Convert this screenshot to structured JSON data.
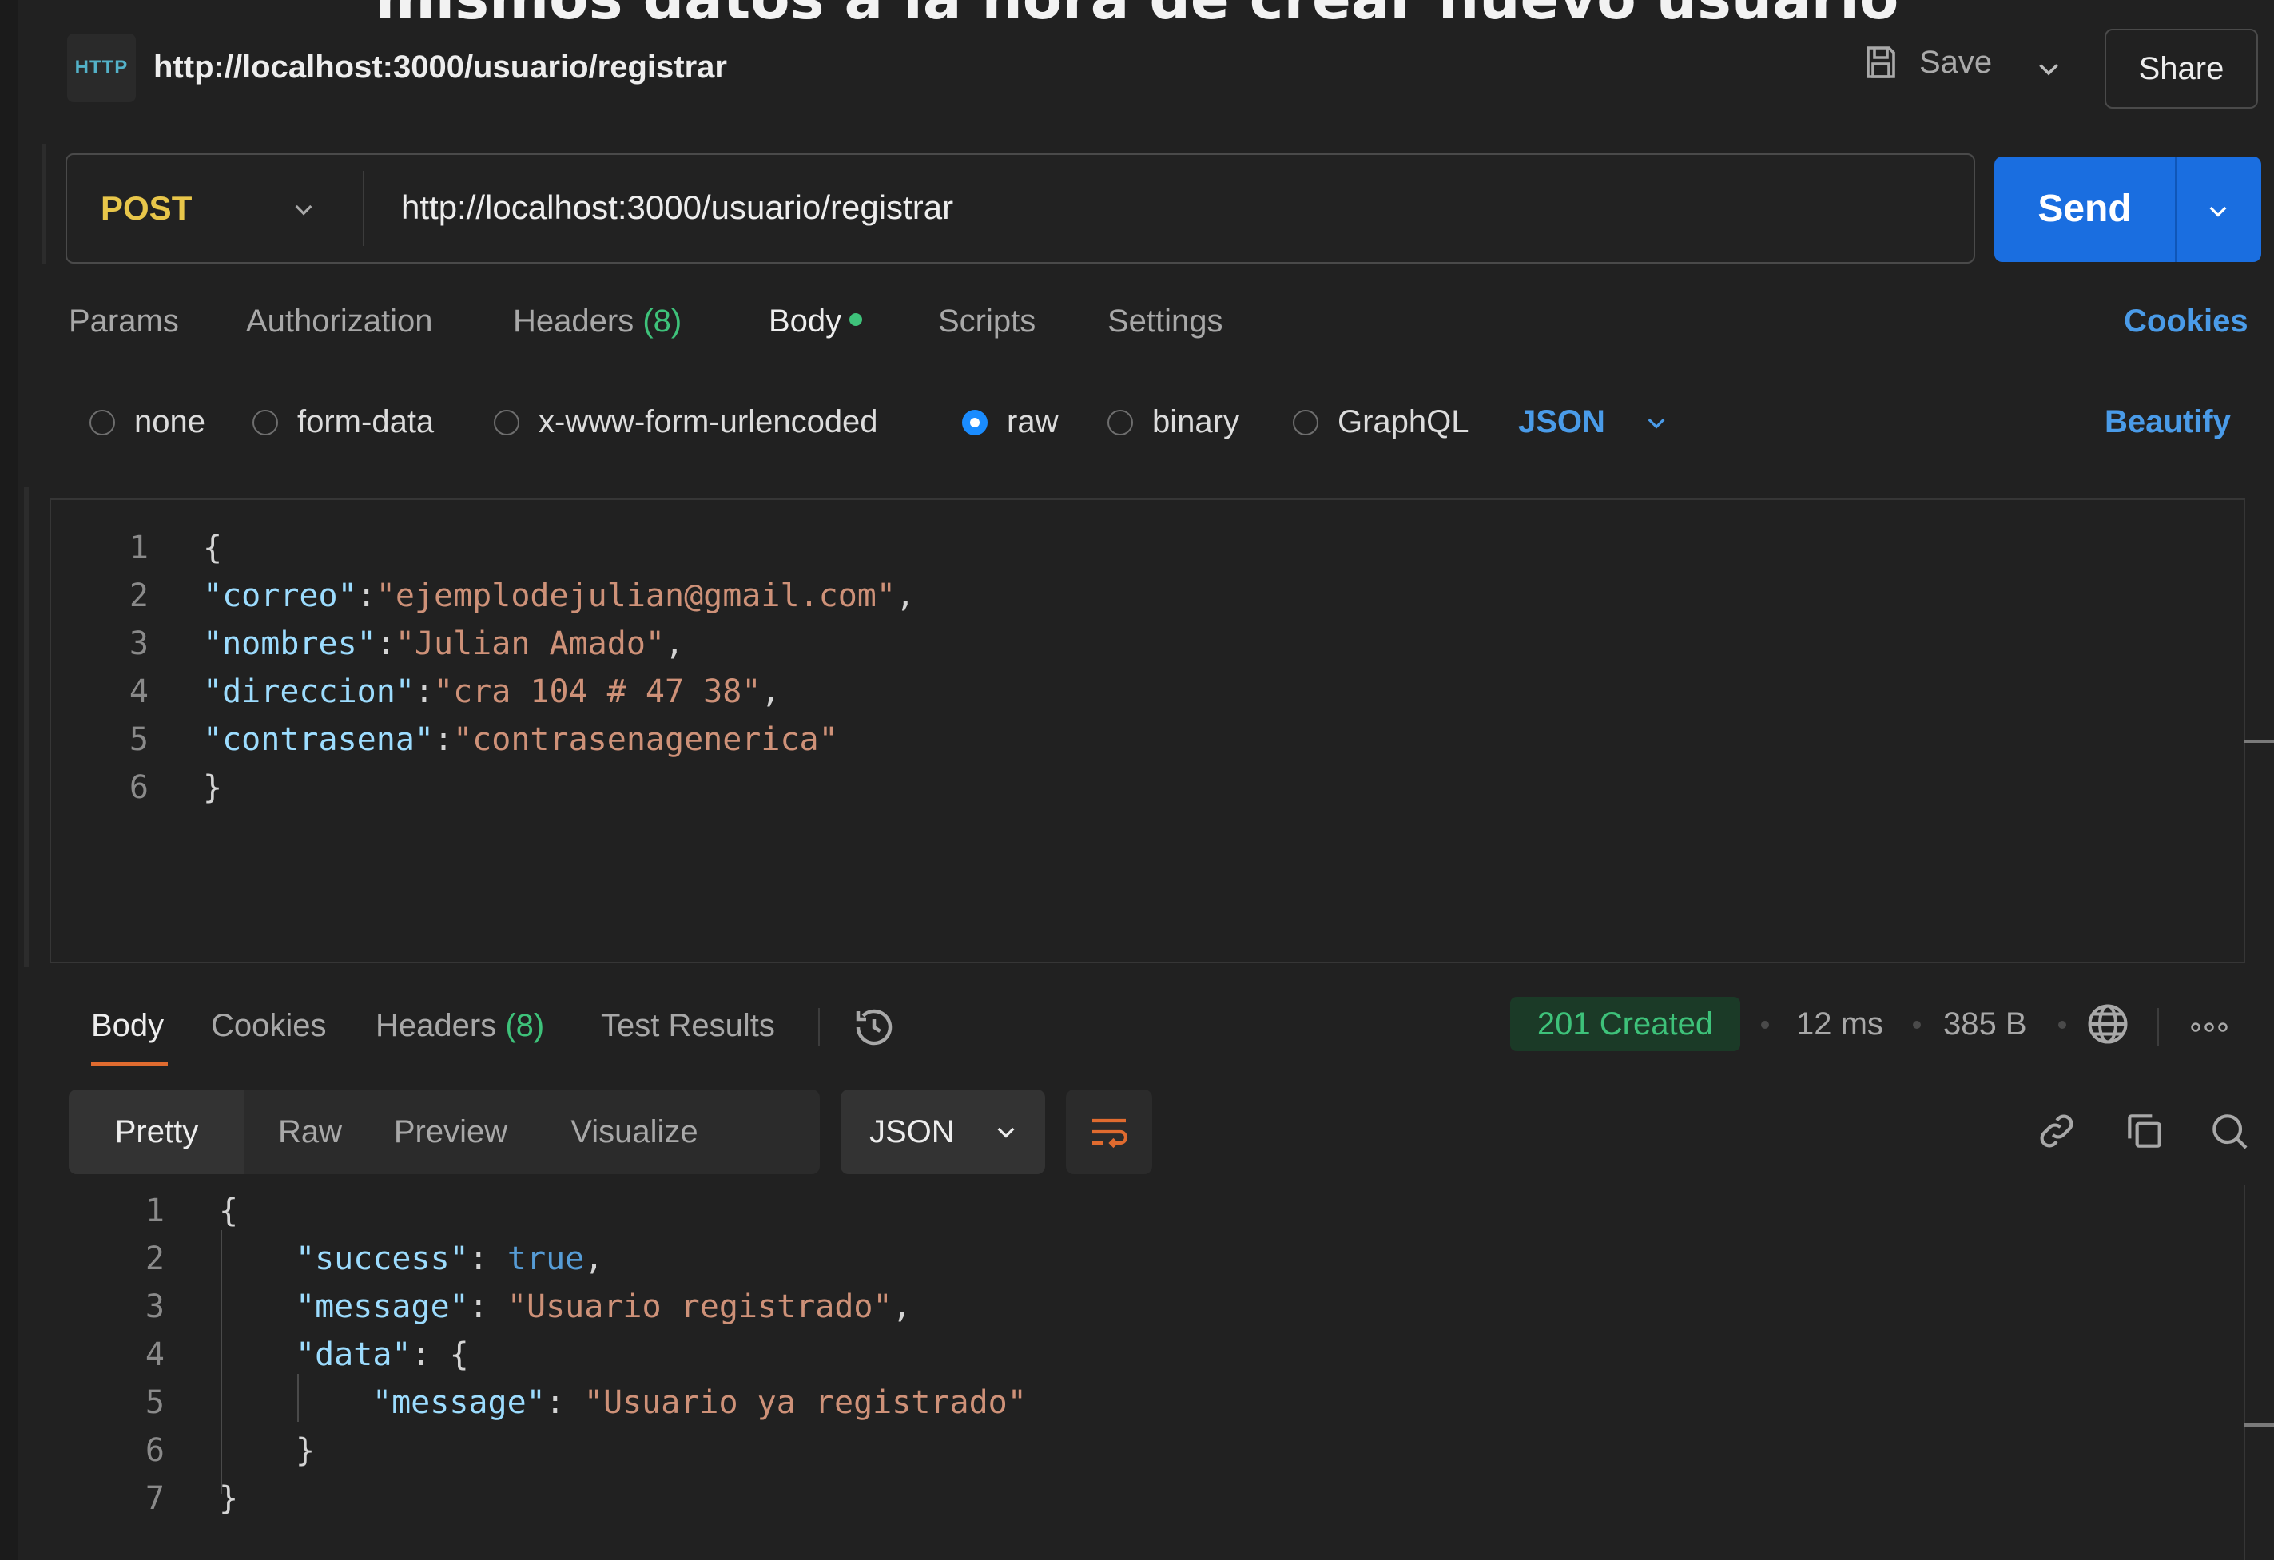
{
  "caption": "mismos datos a la hora de crear nuevo usuario",
  "header": {
    "badge": "HTTP",
    "title": "http://localhost:3000/usuario/registrar",
    "save_label": "Save",
    "share_label": "Share"
  },
  "request": {
    "method": "POST",
    "url": "http://localhost:3000/usuario/registrar",
    "send_label": "Send"
  },
  "request_tabs": {
    "params": "Params",
    "authorization": "Authorization",
    "headers": "Headers",
    "headers_count": "(8)",
    "body": "Body",
    "scripts": "Scripts",
    "settings": "Settings",
    "cookies": "Cookies"
  },
  "body_options": {
    "none": "none",
    "form_data": "form-data",
    "urlencoded": "x-www-form-urlencoded",
    "raw": "raw",
    "binary": "binary",
    "graphql": "GraphQL",
    "selected": "raw",
    "language": "JSON",
    "beautify": "Beautify"
  },
  "request_body": {
    "line_numbers": [
      "1",
      "2",
      "3",
      "4",
      "5",
      "6"
    ],
    "open_brace": "{",
    "close_brace": "}",
    "fields": [
      {
        "key": "\"correo\"",
        "value": "\"ejemplodejulian@gmail.com\"",
        "trail": ","
      },
      {
        "key": "\"nombres\"",
        "value": "\"Julian Amado\"",
        "trail": ","
      },
      {
        "key": "\"direccion\"",
        "value": "\"cra 104 # 47 38\"",
        "trail": ","
      },
      {
        "key": "\"contrasena\"",
        "value": "\"contrasenagenerica\"",
        "trail": ""
      }
    ]
  },
  "response_tabs": {
    "body": "Body",
    "cookies": "Cookies",
    "headers": "Headers",
    "headers_count": "(8)",
    "test_results": "Test Results"
  },
  "response_meta": {
    "status": "201 Created",
    "time": "12 ms",
    "size": "385 B"
  },
  "response_view": {
    "pretty": "Pretty",
    "raw": "Raw",
    "preview": "Preview",
    "visualize": "Visualize",
    "language": "JSON"
  },
  "response_body": {
    "line_numbers": [
      "1",
      "2",
      "3",
      "4",
      "5",
      "6",
      "7"
    ],
    "open_brace": "{",
    "close_brace": "}",
    "success_key": "\"success\"",
    "success_value": "true",
    "message_key": "\"message\"",
    "message_value": "\"Usuario registrado\"",
    "data_key": "\"data\"",
    "inner_message_key": "\"message\"",
    "inner_message_value": "\"Usuario ya registrado\""
  },
  "colors": {
    "accent": "#1a6ee0",
    "method": "#e8c64a",
    "success": "#3ec27a",
    "link": "#4a9be8"
  }
}
